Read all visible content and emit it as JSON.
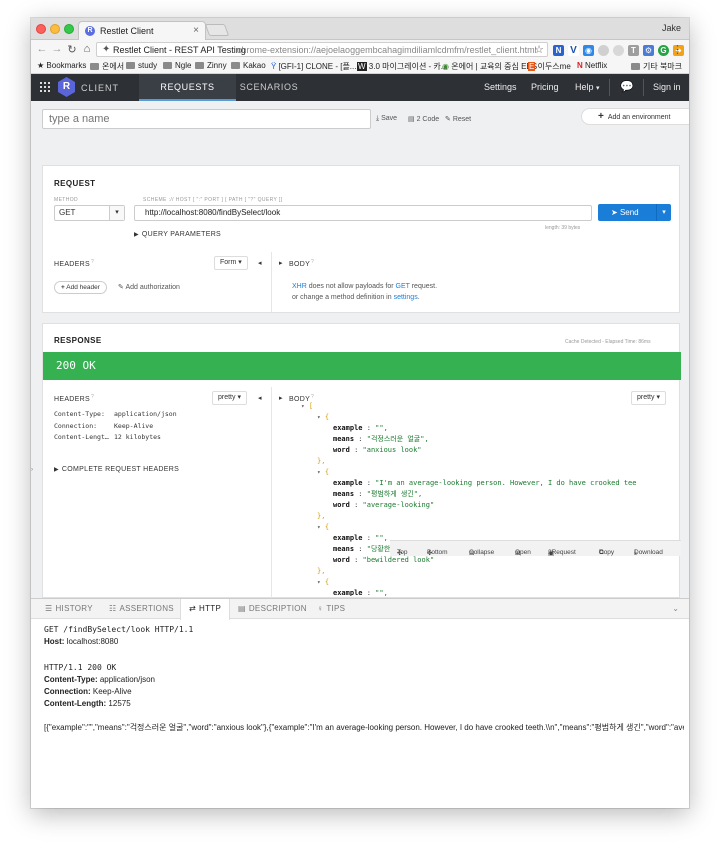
{
  "browser": {
    "tab_title": "Restlet Client",
    "tab_favicon": "R",
    "user": "Jake",
    "site_label": "Restlet Client - REST API Testing",
    "url": "chrome-extension://aejoelaoggembcahagimdiliamlcdmfm/restlet_client.html",
    "bookmarks": [
      "Bookmarks",
      "온에서",
      "study",
      "Ngle",
      "Zinny",
      "Kakao",
      "[GFI-1] CLONE - [플...",
      "3.0 마이그레이션 - 카...",
      "온에어 | 교육의 중심 EBS",
      "이두스me",
      "Netflix",
      "기타 북마크"
    ]
  },
  "nav": {
    "logo_letter": "R",
    "logo_text": "CLIENT",
    "tabs": [
      "REQUESTS",
      "SCENARIOS"
    ],
    "active_tab": "REQUESTS",
    "right": [
      "Settings",
      "Pricing",
      "Help",
      "Sign in"
    ]
  },
  "toolbar": {
    "name_placeholder": "type a name",
    "save": "Save",
    "code": "2 Code",
    "reset": "Reset",
    "add_env": "Add an environment"
  },
  "request": {
    "title": "REQUEST",
    "method_label": "METHOD",
    "scheme_hint": "SCHEME :// HOST [ \":\" PORT ] [ PATH [ \"?\" QUERY ]]",
    "method": "GET",
    "url": "http://localhost:8080/findBySelect/look",
    "send": "Send",
    "length": "length: 39 bytes",
    "query_params": "QUERY PARAMETERS",
    "headers": "HEADERS",
    "form_btn": "Form",
    "body": "BODY",
    "add_header": "Add header",
    "add_auth": "Add authorization",
    "body_msg_xhr": "XHR",
    "body_msg_1": " does not allow payloads for ",
    "body_msg_get": "GET",
    "body_msg_2": " request.",
    "body_msg_3": "or change a method definition in ",
    "body_msg_settings": "settings",
    "body_msg_4": "."
  },
  "response": {
    "title": "RESPONSE",
    "meta": "Cache Detected - Elapsed Time: 86ms",
    "status": "200 OK",
    "headers_label": "HEADERS",
    "body_label": "BODY",
    "pretty": "pretty",
    "header_rows": [
      {
        "k": "Content-Type:",
        "v": "application/json"
      },
      {
        "k": "Connection:",
        "v": "Keep-Alive"
      },
      {
        "k": "Content-Lengt…",
        "v": "12 kilobytes"
      }
    ],
    "complete_headers": "COMPLETE REQUEST HEADERS",
    "json": {
      "open": "[",
      "items": [
        {
          "example": "\"\",",
          "means": "\"걱정스러운 얼굴\",",
          "word": "\"anxious look\""
        },
        {
          "example": "\"I'm an average-looking person. However, I do have crooked tee",
          "means": "\"평범하게 생긴\",",
          "word": "\"average-looking\""
        },
        {
          "example": "\"\",",
          "means": "\"당황한 표정\",",
          "word": "\"bewildered look\""
        },
        {
          "example": "\"\","
        }
      ],
      "k_example": "example",
      "k_means": "means",
      "k_word": "word",
      "sep": " : ",
      "brace_open": "{",
      "brace_close": "},",
      "toggle": "▾"
    },
    "actions": [
      "Top",
      "Bottom",
      "Collapse",
      "Open",
      "2Request",
      "Copy",
      "Download"
    ]
  },
  "bottom": {
    "tabs": [
      "HISTORY",
      "ASSERTIONS",
      "HTTP",
      "DESCRIPTION",
      "TIPS"
    ],
    "active": "HTTP",
    "req_line": "GET /findBySelect/look HTTP/1.1",
    "host_k": "Host:",
    "host_v": " localhost:8080",
    "resp_line": "HTTP/1.1 200 OK",
    "ct_k": "Content-Type:",
    "ct_v": " application/json",
    "conn_k": "Connection:",
    "conn_v": " Keep-Alive",
    "cl_k": "Content-Length:",
    "cl_v": " 12575",
    "raw_body": "[{\"example\":\"\",\"means\":\"걱정스러운 얼굴\",\"word\":\"anxious look\"},{\"example\":\"I'm an average-looking person. However, I do have crooked teeth.\\\\n\",\"means\":\"평범하게 생긴\",\"word\":\"ave"
  },
  "colors": {
    "nav_bg": "#2d3035",
    "accent_blue": "#1a7ed8",
    "status_green": "#35b152",
    "logo_purple": "#5a65d9"
  }
}
